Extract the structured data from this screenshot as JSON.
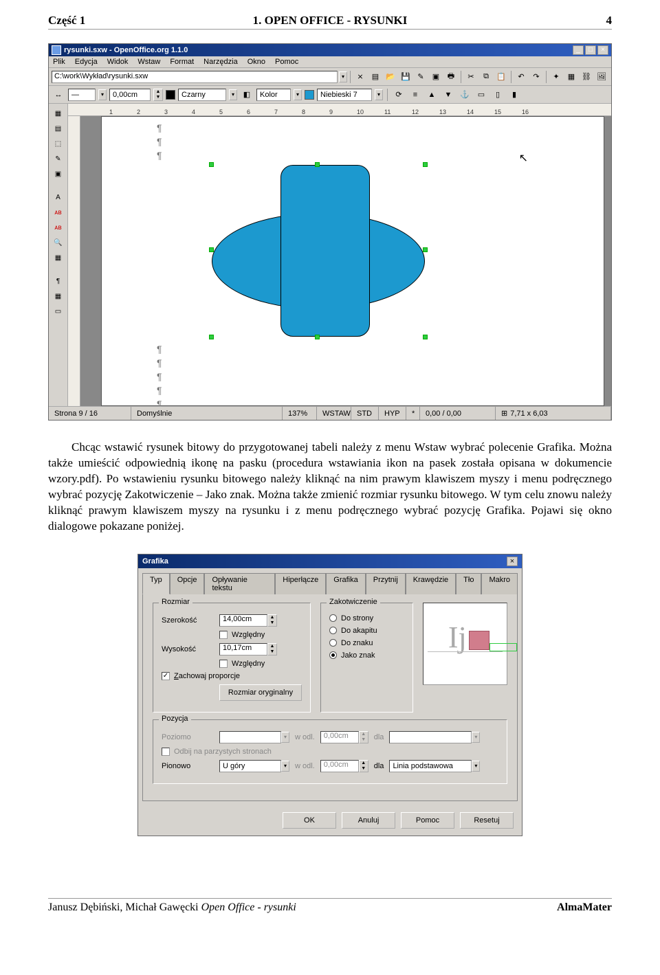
{
  "page_header": {
    "left": "Część 1",
    "center": "1. OPEN OFFICE - RYSUNKI",
    "right": "4"
  },
  "oo": {
    "title": "rysunki.sxw - OpenOffice.org 1.1.0",
    "menu": [
      "Plik",
      "Edycja",
      "Widok",
      "Wstaw",
      "Format",
      "Narzędzia",
      "Okno",
      "Pomoc"
    ],
    "url": "C:\\work\\Wykład\\rysunki.sxw",
    "line_width": "0,00cm",
    "line_width_label": "",
    "color1_label": "Czarny",
    "fill_label": "Kolor",
    "color2_label": "Niebieski 7",
    "status": {
      "page": "Strona 9 / 16",
      "style": "Domyślnie",
      "zoom": "137%",
      "ins": "WSTAW",
      "std": "STD",
      "hyp": "HYP",
      "star": "*",
      "coord": "0,00 / 0,00",
      "size": "7,71 x 6,03"
    },
    "ruler_ticks": [
      "1",
      "2",
      "3",
      "4",
      "5",
      "6",
      "7",
      "8",
      "9",
      "10",
      "11",
      "12",
      "13",
      "14",
      "15",
      "16"
    ]
  },
  "paragraph": "Chcąc wstawić rysunek bitowy do przygotowanej tabeli należy z menu Wstaw wybrać polecenie Grafika. Można także umieścić odpowiednią ikonę na pasku (procedura wstawiania ikon na pasek została opisana w dokumencie wzory.pdf). Po wstawieniu rysunku bitowego należy kliknąć na nim prawym klawiszem myszy i menu podręcznego wybrać pozycję Zakotwiczenie – Jako znak. Można także zmienić rozmiar rysunku bitowego. W tym celu znowu należy kliknąć prawym klawiszem myszy na rysunku i z menu podręcznego wybrać pozycję Grafika. Pojawi się okno dialogowe pokazane poniżej.",
  "dlg": {
    "title": "Grafika",
    "tabs": [
      "Typ",
      "Opcje",
      "Opływanie tekstu",
      "Hiperłącze",
      "Grafika",
      "Przytnij",
      "Krawędzie",
      "Tło",
      "Makro"
    ],
    "group_size": "Rozmiar",
    "width_label": "Szerokość",
    "width_val": "14,00cm",
    "height_label": "Wysokość",
    "height_val": "10,17cm",
    "relative": "Względny",
    "keep_ratio": "Zachowaj proporcje",
    "orig_size_btn": "Rozmiar oryginalny",
    "group_anchor": "Zakotwiczenie",
    "anchor_opts": [
      "Do strony",
      "Do akapitu",
      "Do znaku",
      "Jako znak"
    ],
    "group_pos": "Pozycja",
    "horiz": "Poziomo",
    "mirror": "Odbij na parzystych stronach",
    "vert": "Pionowo",
    "vert_val": "U góry",
    "wodl": "w odl.",
    "wodl_val": "0,00cm",
    "dla": "dla",
    "dla_val": "Linia podstawowa",
    "buttons": {
      "ok": "OK",
      "cancel": "Anuluj",
      "help": "Pomoc",
      "reset": "Resetuj"
    }
  },
  "footer": {
    "author": "Janusz Dębiński, Michał Gawęcki",
    "title_italic": "Open Office - rysunki",
    "right": "AlmaMater"
  }
}
